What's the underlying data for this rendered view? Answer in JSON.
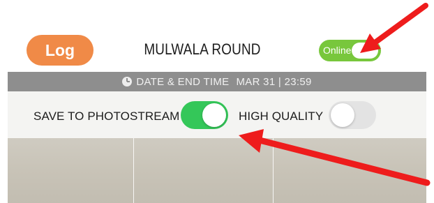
{
  "header": {
    "log_label": "Log",
    "title": "MULWALA ROUND",
    "online_label": "Online"
  },
  "date_strip": {
    "icon": "clock-icon",
    "label": "DATE & END TIME",
    "value": "MAR 31 | 23:59"
  },
  "options": {
    "photostream_label": "SAVE TO PHOTOSTREAM",
    "photostream_on": true,
    "high_quality_label": "HIGH QUALITY",
    "high_quality_on": false
  },
  "colors": {
    "log_button": "#f08a47",
    "online_toggle": "#78c73c",
    "switch_on": "#34c759",
    "switch_off": "#e3e3e3",
    "date_strip": "#8e8e8e",
    "annotation_arrow": "#ee1c1c"
  }
}
